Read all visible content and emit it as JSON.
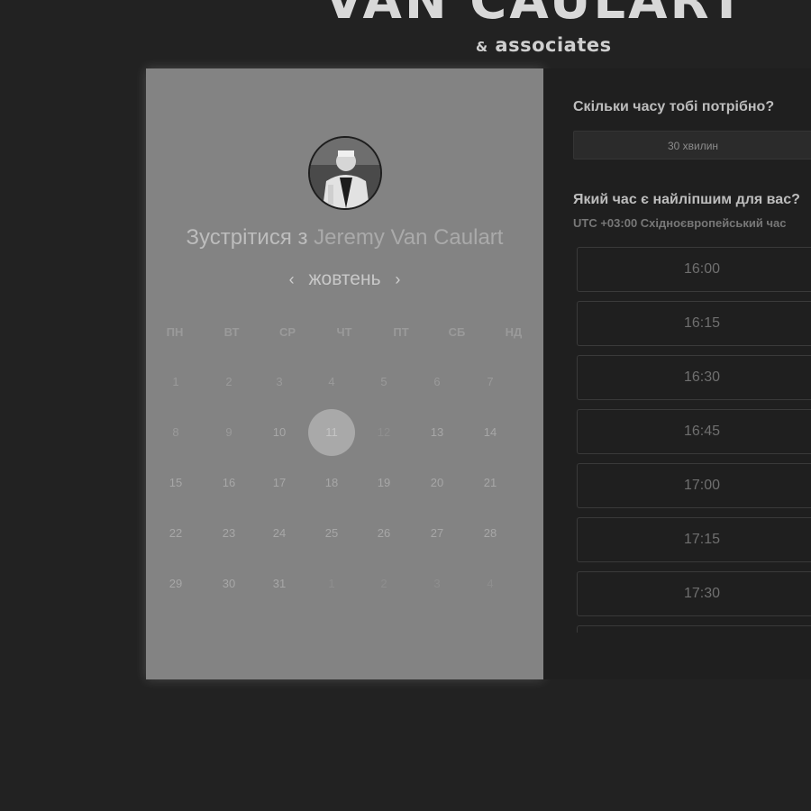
{
  "brand": {
    "title": "VAN CAULART",
    "subtitle_amp": "&",
    "subtitle_text": " associates"
  },
  "calendar": {
    "heading_prefix": "Зустрітися з ",
    "heading_name": "Jeremy Van Caulart",
    "month": "жовтень",
    "prev_arrow": "‹",
    "next_arrow": "›",
    "weekdays": [
      "ПН",
      "ВТ",
      "СР",
      "ЧТ",
      "ПТ",
      "СБ",
      "НД"
    ],
    "weeks": [
      [
        "1",
        "2",
        "3",
        "4",
        "5",
        "6",
        "7"
      ],
      [
        "8",
        "9",
        "10",
        "11",
        "12",
        "13",
        "14"
      ],
      [
        "15",
        "16",
        "17",
        "18",
        "19",
        "20",
        "21"
      ],
      [
        "22",
        "23",
        "24",
        "25",
        "26",
        "27",
        "28"
      ],
      [
        "29",
        "30",
        "31",
        "1",
        "2",
        "3",
        "4"
      ]
    ],
    "selected_day": "11"
  },
  "booking": {
    "duration_question": "Скільки часу тобі потрібно?",
    "duration_value": "30 хвилин",
    "time_question": "Який час є найліпшим для вас?",
    "timezone": "UTC +03:00 Східноєвропейський час",
    "time_slots": [
      "16:00",
      "16:15",
      "16:30",
      "16:45",
      "17:00",
      "17:15",
      "17:30",
      ""
    ]
  }
}
